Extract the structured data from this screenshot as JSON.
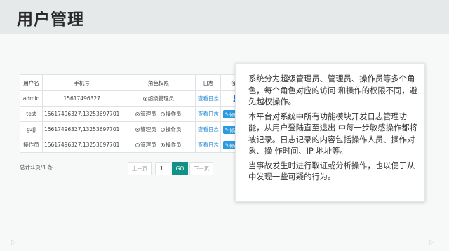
{
  "header": {
    "title": "用户管理"
  },
  "table": {
    "headers": [
      "用户名",
      "手机号",
      "角色权限",
      "日志",
      "操作"
    ],
    "rows": [
      {
        "user": "admin",
        "phone": "15617496327",
        "role_options": [
          "超级管理员"
        ],
        "log": "查看日志",
        "action": "user-icon"
      },
      {
        "user": "test",
        "phone": "15617496327,13253697701",
        "role_options": [
          "管理员",
          "操作员"
        ],
        "selected": "管理员",
        "log": "查看日志",
        "action": "修改角色"
      },
      {
        "user": "gzjj",
        "phone": "15617496327,13253697701",
        "role_options": [
          "管理员",
          "操作员"
        ],
        "selected": "管理员",
        "log": "查看日志",
        "action": "修改角色"
      },
      {
        "user": "操作员",
        "phone": "15617496327,13253697701",
        "role_options": [
          "管理员",
          "操作员"
        ],
        "selected": "操作员",
        "log": "查看日志",
        "action": "修改角色"
      }
    ]
  },
  "pagination": {
    "total": "总计:1页/4 条",
    "prev": "上一页",
    "page": "1",
    "go": "GO",
    "next": "下一页"
  },
  "description": {
    "paragraphs": [
      "系统分为超级管理员、管理员、操作员等多个角色，每个角色对应的访问 和操作的权限不同，避免越权操作。",
      "本平台对系统中所有功能模块开发日志管理功能，从用户登陆直至退出 中每一步敏感操作都将被记录。日志记录的内容包括操作人员、操作对象、操 作时间、IP 地址等。",
      "当事故发生时进行取证或分析操作，也以便于从中发现一些可疑的行为。"
    ]
  },
  "colors": {
    "accent": "#2b9be0",
    "go": "#119285",
    "link": "#2a8bd6"
  }
}
